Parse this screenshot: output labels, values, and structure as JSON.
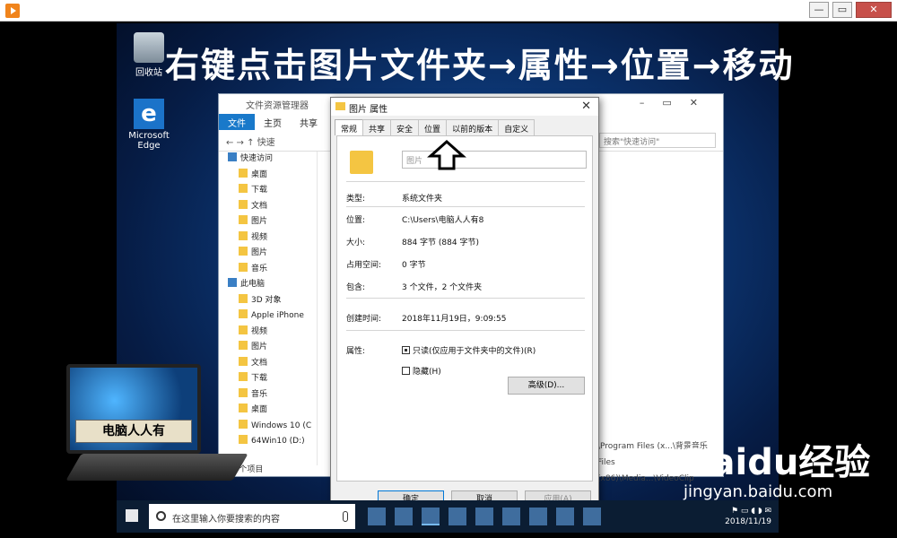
{
  "player": {
    "close_glyph": "✕",
    "min_glyph": "—",
    "max_glyph": "▭"
  },
  "caption": "右键点击图片文件夹→属性→位置→移动",
  "desktop_icons": {
    "recycle": "回收站",
    "edge_line1": "Microsoft",
    "edge_line2": "Edge"
  },
  "explorer": {
    "title": "文件资源管理器",
    "ribbon": [
      "文件",
      "主页",
      "共享"
    ],
    "address": "快速",
    "search_placeholder": "搜索\"快速访问\"",
    "nav": [
      {
        "label": "快速访问",
        "level": 1
      },
      {
        "label": "桌面",
        "level": 2
      },
      {
        "label": "下载",
        "level": 2
      },
      {
        "label": "文档",
        "level": 2
      },
      {
        "label": "图片",
        "level": 2
      },
      {
        "label": "视频",
        "level": 2
      },
      {
        "label": "图片",
        "level": 2
      },
      {
        "label": "音乐",
        "level": 2
      },
      {
        "label": "此电脑",
        "level": 1
      },
      {
        "label": "3D 对象",
        "level": 2
      },
      {
        "label": "Apple iPhone",
        "level": 2
      },
      {
        "label": "视频",
        "level": 2
      },
      {
        "label": "图片",
        "level": 2
      },
      {
        "label": "文档",
        "level": 2
      },
      {
        "label": "下载",
        "level": 2
      },
      {
        "label": "音乐",
        "level": 2
      },
      {
        "label": "桌面",
        "level": 2
      },
      {
        "label": "Windows 10 (C",
        "level": 2
      },
      {
        "label": "64Win10 (D:)",
        "level": 2
      }
    ],
    "status": "16 个项目",
    "paths": [
      "\\Program Files (x...\\背景音乐",
      "Files (x86)\\Media...\\VideoClip"
    ]
  },
  "dialog": {
    "title": "图片 属性",
    "tabs": [
      "常规",
      "共享",
      "安全",
      "位置",
      "以前的版本",
      "自定义"
    ],
    "name_value": "图片",
    "rows": [
      {
        "label": "类型:",
        "value": "系统文件夹"
      },
      {
        "label": "位置:",
        "value": "C:\\Users\\电脑人人有8"
      },
      {
        "label": "大小:",
        "value": "884 字节 (884 字节)"
      },
      {
        "label": "占用空间:",
        "value": "0 字节"
      },
      {
        "label": "包含:",
        "value": "3 个文件，2 个文件夹"
      },
      {
        "label": "创建时间:",
        "value": "2018年11月19日，9:09:55"
      }
    ],
    "attr_label": "属性:",
    "readonly_label": "只读(仅应用于文件夹中的文件)(R)",
    "hidden_label": "隐藏(H)",
    "advanced_button": "高级(D)...",
    "ok": "确定",
    "cancel": "取消",
    "apply": "应用(A)"
  },
  "taskbar": {
    "search_placeholder": "在这里输入你要搜索的内容",
    "date": "2018/11/19"
  },
  "overlay": {
    "brand": "电脑人人有",
    "watermark_logo": "Baidu经验",
    "watermark_url": "jingyan.baidu.com"
  }
}
